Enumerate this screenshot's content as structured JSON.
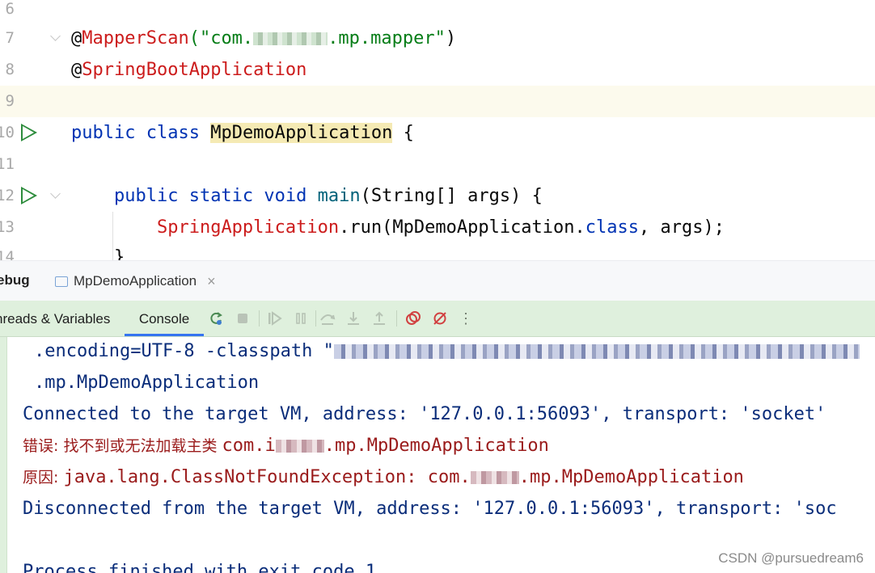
{
  "editor": {
    "lines": [
      {
        "num": "6"
      },
      {
        "num": "7",
        "ann": "MapperScan",
        "str_pre": "(\"com.",
        "str_post": ".mp.mapper\"",
        "tail": ")"
      },
      {
        "num": "8",
        "ann": "SpringBootApplication"
      },
      {
        "num": "9"
      },
      {
        "num": "10",
        "kw": "public class",
        "name": "MpDemoApplication",
        "tail": " {"
      },
      {
        "num": "11"
      },
      {
        "num": "12",
        "kw": "public static void",
        "method": "main",
        "tail": "(String[] args) {"
      },
      {
        "num": "13",
        "cls": "SpringApplication",
        "call": ".run(MpDemoApplication.",
        "kw2": "class",
        "tail": ", args);"
      },
      {
        "num": "14",
        "text": "}"
      }
    ],
    "at_sign": "@"
  },
  "toolwindow": {
    "title": "ebug",
    "run_tab": "MpDemoApplication",
    "close_glyph": "×"
  },
  "debugger": {
    "tabs": {
      "threads": "nreads & Variables",
      "console": "Console"
    }
  },
  "console": {
    "line1_pre": ".encoding=UTF-8 -classpath \"",
    "line2": ".mp.MpDemoApplication",
    "line3": "Connected to the target VM, address: '127.0.0.1:56093', transport: 'socket'",
    "line4_cjk": "错误: 找不到或无法加载主类 ",
    "line4_pre": "com.i",
    "line4_post": ".mp.MpDemoApplication",
    "line5_cjk": "原因: ",
    "line5_pre": "java.lang.ClassNotFoundException: com.",
    "line5_post": ".mp.MpDemoApplication",
    "line6": "Disconnected from the target VM, address: '127.0.0.1:56093', transport: 'soc",
    "line8": "Process finished with exit code 1"
  },
  "watermark": "CSDN @pursuedream6",
  "colors": {
    "annotation": "#cc1c1c",
    "keyword": "#0033b3",
    "string": "#067d17",
    "console_blue": "#0a2d7a",
    "console_error": "#9a1b1b",
    "toolbar_bg": "#dff0dd"
  }
}
